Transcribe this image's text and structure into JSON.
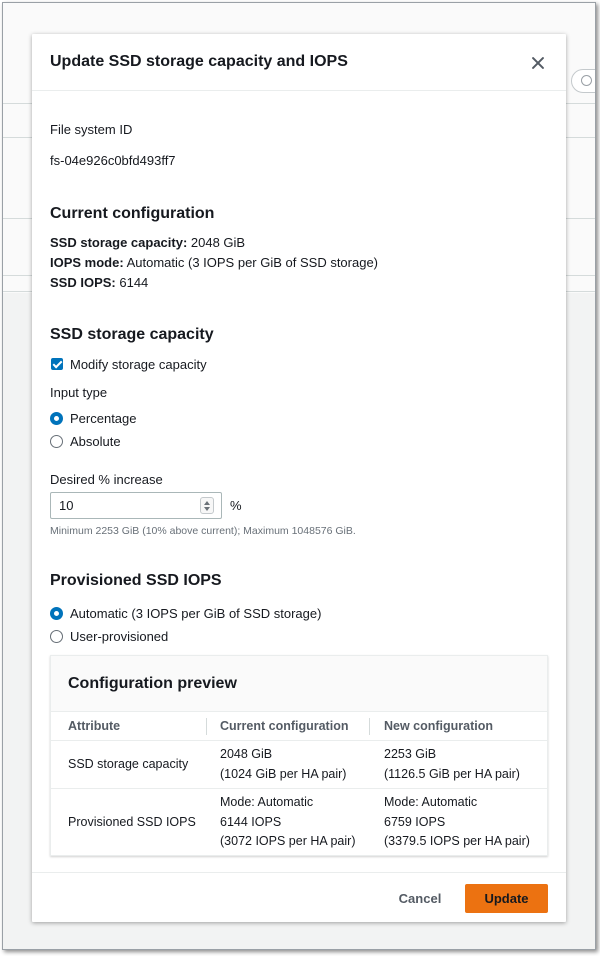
{
  "dialog": {
    "title": "Update SSD storage capacity and IOPS"
  },
  "file_system": {
    "label": "File system ID",
    "value": "fs-04e926c0bfd493ff7"
  },
  "current_configuration": {
    "heading": "Current configuration",
    "capacity_label": "SSD storage capacity:",
    "capacity_value": " 2048 GiB",
    "iops_mode_label": "IOPS mode:",
    "iops_mode_value": " Automatic (3 IOPS per GiB of SSD storage)",
    "iops_label": "SSD IOPS:",
    "iops_value": " 6144"
  },
  "storage_capacity": {
    "heading": "SSD storage capacity",
    "modify_checkbox_label": "Modify storage capacity",
    "modify_checked": true,
    "input_type_label": "Input type",
    "options": [
      "Percentage",
      "Absolute"
    ],
    "selected_option": "Percentage",
    "desired_label": "Desired % increase",
    "desired_value": "10",
    "unit": "%",
    "hint": "Minimum 2253 GiB (10% above current); Maximum 1048576 GiB."
  },
  "provisioned_iops": {
    "heading": "Provisioned SSD IOPS",
    "options": [
      "Automatic (3 IOPS per GiB of SSD storage)",
      "User-provisioned"
    ],
    "selected_option": "Automatic (3 IOPS per GiB of SSD storage)"
  },
  "preview": {
    "title": "Configuration preview",
    "columns": [
      "Attribute",
      "Current configuration",
      "New configuration"
    ],
    "rows": [
      {
        "attribute": "SSD storage capacity",
        "current": [
          "2048 GiB",
          "(1024 GiB per HA pair)"
        ],
        "new": [
          "2253 GiB",
          "(1126.5 GiB per HA pair)"
        ]
      },
      {
        "attribute": "Provisioned SSD IOPS",
        "current": [
          "Mode: Automatic",
          "6144 IOPS",
          "(3072 IOPS per HA pair)"
        ],
        "new": [
          "Mode: Automatic",
          "6759 IOPS",
          "(3379.5 IOPS per HA pair)"
        ]
      }
    ]
  },
  "footer": {
    "cancel_label": "Cancel",
    "update_label": "Update"
  },
  "colors": {
    "primary_button": "#ec7211",
    "accent_blue": "#0073bb"
  }
}
